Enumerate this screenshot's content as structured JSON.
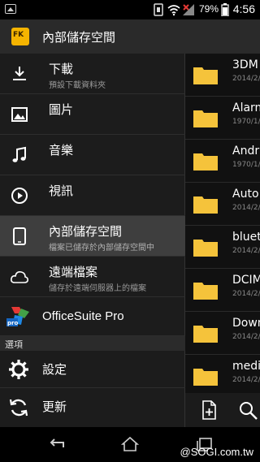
{
  "status_bar": {
    "battery_percent": "79%",
    "time": "4:56"
  },
  "app_bar": {
    "logo_text": "FK",
    "title": "內部儲存空間"
  },
  "drawer": {
    "items": [
      {
        "label": "下載",
        "sub": "預設下載資料夾",
        "icon": "download-icon"
      },
      {
        "label": "圖片",
        "sub": "",
        "icon": "image-icon"
      },
      {
        "label": "音樂",
        "sub": "",
        "icon": "music-note-icon"
      },
      {
        "label": "視訊",
        "sub": "",
        "icon": "play-circle-icon"
      },
      {
        "label": "內部儲存空間",
        "sub": "檔案已儲存於內部儲存空間中",
        "icon": "tablet-icon"
      },
      {
        "label": "遠端檔案",
        "sub": "儲存於遠端伺服器上的檔案",
        "icon": "cloud-icon"
      },
      {
        "label": "OfficeSuite Pro",
        "sub": "",
        "icon": "officesuite-logo-icon"
      }
    ],
    "section_header": "選項",
    "options": [
      {
        "label": "設定",
        "icon": "gear-icon"
      },
      {
        "label": "更新",
        "icon": "refresh-icon"
      }
    ]
  },
  "files": [
    {
      "name": "3DM",
      "date": "2014/2/"
    },
    {
      "name": "Alarm",
      "date": "1970/1/"
    },
    {
      "name": "Andr",
      "date": "1970/1/"
    },
    {
      "name": "Auto",
      "date": "2014/2/"
    },
    {
      "name": "bluet",
      "date": "2014/2/"
    },
    {
      "name": "DCIM",
      "date": "2014/2/"
    },
    {
      "name": "Down",
      "date": "2014/2/"
    },
    {
      "name": "medi",
      "date": "2014/2/"
    }
  ],
  "watermark": "@SOGI.com.tw",
  "colors": {
    "folder": "#f5c33b",
    "accent": "#f5b400",
    "drawer_bg": "#1c1c1c",
    "selected_bg": "#3e3e3e"
  }
}
